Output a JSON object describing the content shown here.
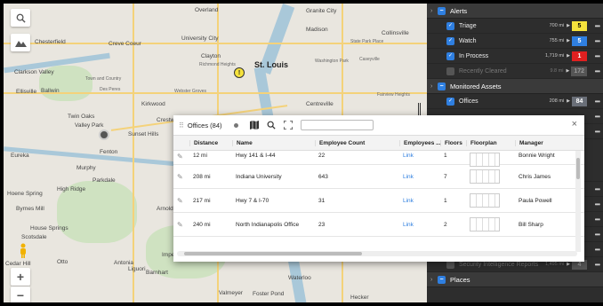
{
  "map": {
    "labels": [
      "Overland",
      "Granite City",
      "Madison",
      "Collinsville",
      "State Park Place",
      "Chesterfield",
      "Creve Coeur",
      "University City",
      "Clayton",
      "Richmond Heights",
      "St. Louis",
      "Washington Park",
      "Caseyville",
      "Clarkson Valley",
      "Town and Country",
      "Ellisville",
      "Ballwin",
      "Des Peres",
      "Webster Groves",
      "Kirkwood",
      "Centreville",
      "Fairview Heights",
      "Twin Oaks",
      "Valley Park",
      "Sunset Hills",
      "Crestwood",
      "Fenton",
      "Eureka",
      "Murphy",
      "Parkdale",
      "High Ridge",
      "Byrnes Mill",
      "House Springs",
      "Scotsdale",
      "Arnold",
      "Imperial",
      "Otto",
      "Antonia",
      "Liguori",
      "Barnhart",
      "Waterloo",
      "Valmeyer",
      "Foster Pond",
      "Hecker",
      "Cedar Hill",
      "Hoene Spring"
    ],
    "alert_pin_glyph": "!",
    "zoom_in": "+",
    "zoom_out": "−"
  },
  "panel": {
    "alerts_header": "Alerts",
    "alerts": [
      {
        "name": "Triage",
        "dist": "700 mi",
        "count": "5",
        "badge_color": "#f5e23c",
        "text_color": "#000",
        "on": true
      },
      {
        "name": "Watch",
        "dist": "755 mi",
        "count": "5",
        "badge_color": "#2f7fe0",
        "text_color": "#fff",
        "on": true
      },
      {
        "name": "In Process",
        "dist": "1,719 mi",
        "count": "1",
        "badge_color": "#e02020",
        "text_color": "#fff",
        "on": true
      },
      {
        "name": "Recently Cleared",
        "dist": "9.8 mi",
        "count": "172",
        "badge_color": "#555555",
        "text_color": "#999",
        "on": false
      }
    ],
    "assets_header": "Monitored Assets",
    "assets": [
      {
        "name": "Offices",
        "dist": "208 mi",
        "count": "84",
        "badge_color": "#6a6f78",
        "text_color": "#fff",
        "on": true
      }
    ],
    "security_row": {
      "name": "Security Intelligence Reports",
      "dist": "1,495 mi",
      "count": "4"
    },
    "places_header": "Places",
    "more_glyph": "•••"
  },
  "dialog": {
    "title": "Offices (84)",
    "columns": [
      "Distance",
      "Name",
      "Employee Count",
      "Employees ...",
      "Floors",
      "Floorplan",
      "Manager"
    ],
    "rows": [
      {
        "distance": "12 mi",
        "name": "Hwy 141 & I-44",
        "employees": "22",
        "link": "Link",
        "floors": "1",
        "manager": "Bonnie Wright"
      },
      {
        "distance": "208 mi",
        "name": "Indiana University",
        "employees": "643",
        "link": "Link",
        "floors": "7",
        "manager": "Chris James"
      },
      {
        "distance": "217 mi",
        "name": "Hwy 7 & I-70",
        "employees": "31",
        "link": "Link",
        "floors": "1",
        "manager": "Paula Powell"
      },
      {
        "distance": "240 mi",
        "name": "North Indianapolis Office",
        "employees": "23",
        "link": "Link",
        "floors": "2",
        "manager": "Bill Sharp"
      }
    ],
    "close_glyph": "×"
  }
}
